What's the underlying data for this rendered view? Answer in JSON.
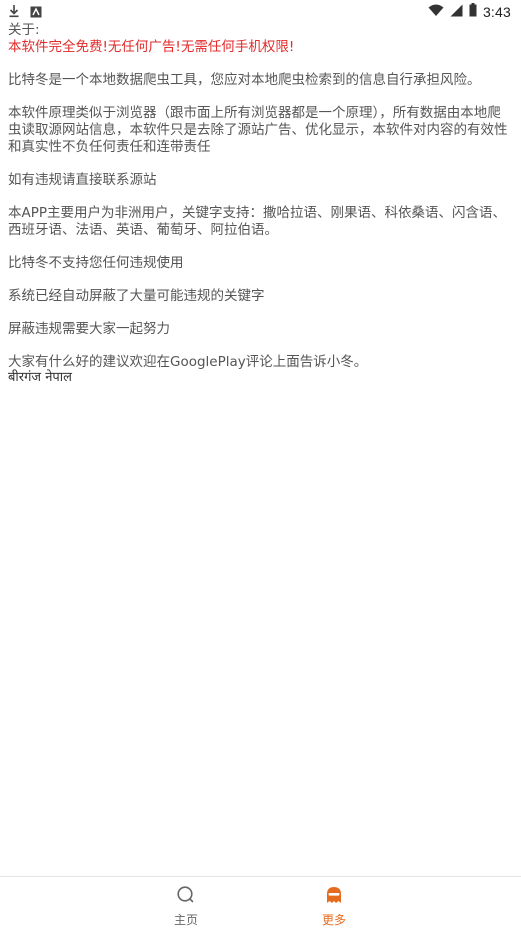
{
  "status_bar": {
    "time": "3:43",
    "left_icons": [
      "download-icon",
      "image-notification-icon"
    ],
    "right_icons": [
      "wifi-icon",
      "signal-icon",
      "battery-icon"
    ]
  },
  "content": {
    "title": "关于:",
    "highlight": "本软件完全免费!无任何广告!无需任何手机权限!",
    "paragraphs": [
      "比特冬是一个本地数据爬虫工具，您应对本地爬虫检索到的信息自行承担风险。",
      "本软件原理类似于浏览器（跟市面上所有浏览器都是一个原理），所有数据由本地爬虫读取源网站信息，本软件只是去除了源站广告、优化显示，本软件对内容的有效性和真实性不负任何责任和连带责任",
      "如有违规请直接联系源站",
      "本APP主要用户为非洲用户，关键字支持：撒哈拉语、刚果语、科依桑语、闪含语、西班牙语、法语、英语、葡萄牙、阿拉伯语。",
      "比特冬不支持您任何违规使用",
      "系统已经自动屏蔽了大量可能违规的关键字",
      "屏蔽违规需要大家一起努力"
    ],
    "last_paragraph": "大家有什么好的建议欢迎在GooglePlay评论上面告诉小冬。",
    "signature": "बीरगंज नेपाल"
  },
  "bottom_nav": {
    "items": [
      {
        "label": "主页",
        "icon": "search-icon"
      },
      {
        "label": "更多",
        "icon": "ghost-icon"
      }
    ],
    "active_color": "#e56c1f",
    "inactive_color": "#666666"
  },
  "colors": {
    "highlight": "#e22b2b",
    "text": "#555555"
  }
}
